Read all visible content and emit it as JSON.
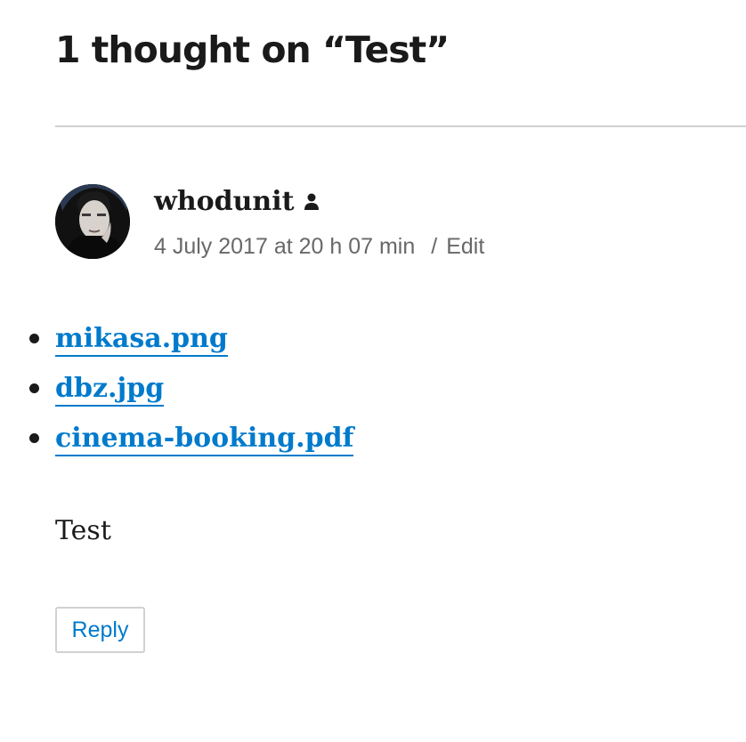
{
  "comments": {
    "title": "1 thought on “Test”"
  },
  "comment": {
    "avatar": {
      "icon": "avatar-icon"
    },
    "author": "whodunit",
    "author_icon": "person-icon",
    "date": "4 July 2017 at 20 h 07 min",
    "separator": "/",
    "edit_label": "Edit",
    "attachments": [
      {
        "label": "mikasa.png"
      },
      {
        "label": "dbz.jpg"
      },
      {
        "label": "cinema-booking.pdf"
      }
    ],
    "text": "Test",
    "reply_label": "Reply"
  },
  "colors": {
    "link": "#007acc",
    "text": "#1a1a1a",
    "meta": "#686868",
    "border": "#d1d1d1"
  }
}
